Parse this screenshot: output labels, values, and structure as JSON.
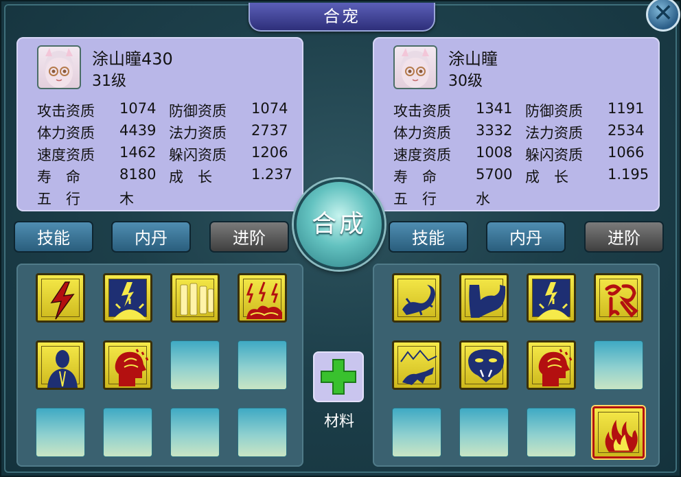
{
  "window": {
    "title": "合宠",
    "close_glyph": "✕"
  },
  "merge_button": "合成",
  "material": {
    "label": "材料",
    "icon": "plus-icon"
  },
  "left_pet": {
    "name": "涂山瞳430",
    "level": "31级",
    "stats": {
      "attack_label": "攻击资质",
      "attack": "1074",
      "defense_label": "防御资质",
      "defense": "1074",
      "stamina_label": "体力资质",
      "stamina": "4439",
      "magic_label": "法力资质",
      "magic": "2737",
      "speed_label": "速度资质",
      "speed": "1462",
      "dodge_label": "躲闪资质",
      "dodge": "1206",
      "life_label": "寿　命",
      "life": "8180",
      "growth_label": "成　长",
      "growth": "1.237",
      "element_label": "五　行",
      "element": "木"
    },
    "tabs": [
      "技能",
      "内丹",
      "进阶"
    ],
    "skills": [
      "lightning-bolt-icon",
      "sun-lightning-icon",
      "scroll-icon",
      "storm-cloud-icon",
      "praying-figure-icon",
      "mind-head-icon"
    ]
  },
  "right_pet": {
    "name": "涂山瞳",
    "level": "30级",
    "stats": {
      "attack_label": "攻击资质",
      "attack": "1341",
      "defense_label": "防御资质",
      "defense": "1191",
      "stamina_label": "体力资质",
      "stamina": "3332",
      "magic_label": "法力资质",
      "magic": "2534",
      "speed_label": "速度资质",
      "speed": "1008",
      "dodge_label": "躲闪资质",
      "dodge": "1066",
      "life_label": "寿　命",
      "life": "5700",
      "growth_label": "成　长",
      "growth": "1.195",
      "element_label": "五　行",
      "element": "水"
    },
    "tabs": [
      "技能",
      "内丹",
      "进阶"
    ],
    "skills": [
      "lizard-icon",
      "strong-arm-icon",
      "sun-lightning-icon",
      "glyph-icon",
      "wolf-mountain-icon",
      "snake-head-icon",
      "mind-head-icon",
      "flame-icon"
    ]
  },
  "colors": {
    "panel": "#b9b7e8",
    "skill_bg": "#f6ea4a",
    "accent_red": "#b31010"
  }
}
